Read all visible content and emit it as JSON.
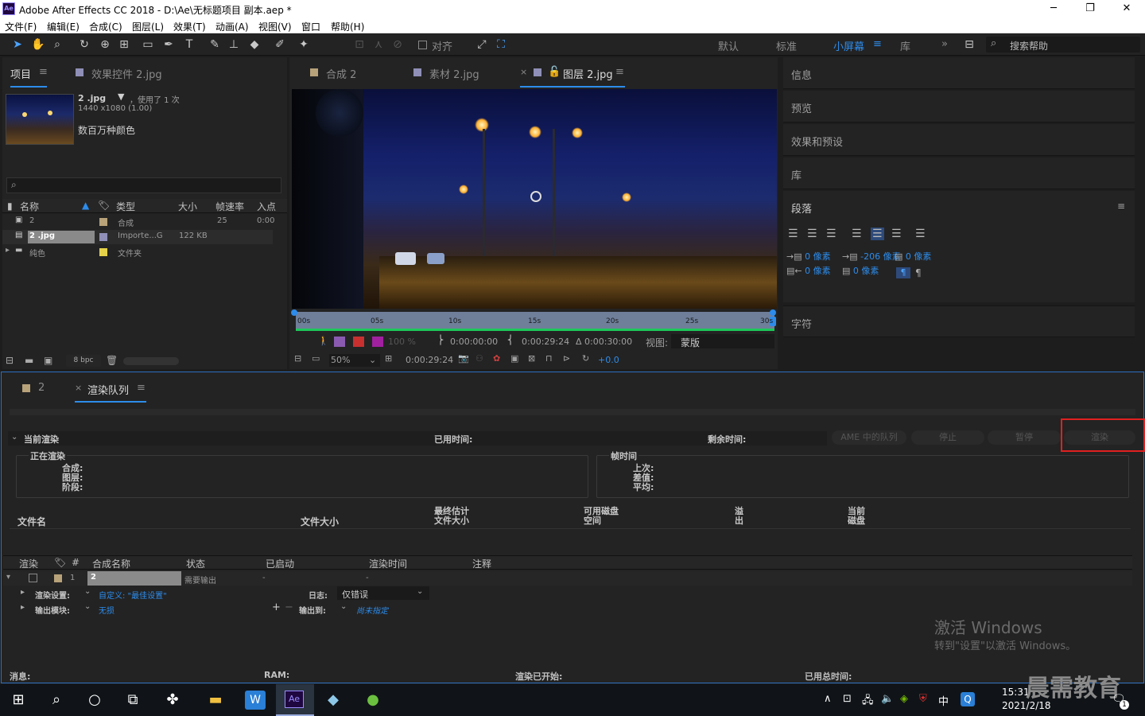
{
  "window": {
    "title": "Adobe After Effects CC 2018 - D:\\Ae\\无标题项目 副本.aep *",
    "app_badge": "Ae"
  },
  "menu": [
    "文件(F)",
    "编辑(E)",
    "合成(C)",
    "图层(L)",
    "效果(T)",
    "动画(A)",
    "视图(V)",
    "窗口",
    "帮助(H)"
  ],
  "toolbar": {
    "snap_label": "对齐",
    "workspaces": [
      "默认",
      "标准",
      "小屏幕",
      "库"
    ],
    "active_workspace": "小屏幕",
    "search_placeholder": "搜索帮助"
  },
  "project_panel": {
    "tab_project": "项目",
    "tab_effects": "效果控件 2.jpg",
    "thumb": {
      "name": "2 .jpg",
      "usage": "，使用了 1 次",
      "dimensions": "1440 x1080 (1.00)",
      "colors": "数百万种颜色"
    },
    "columns": [
      "名称",
      "类型",
      "大小",
      "帧速率",
      "入点"
    ],
    "rows": [
      {
        "name": "2",
        "type": "合成",
        "size": "",
        "fps": "25",
        "in": "0:00"
      },
      {
        "name": "2 .jpg",
        "type": "Importe...G",
        "size": "122 KB",
        "fps": "",
        "in": ""
      },
      {
        "name": "纯色",
        "type": "文件夹",
        "size": "",
        "fps": "",
        "in": ""
      }
    ],
    "bpc": "8 bpc"
  },
  "viewer": {
    "tabs": [
      "合成 2",
      "素材 2.jpg",
      "图层 2.jpg"
    ],
    "ruler": [
      "00s",
      "05s",
      "10s",
      "15s",
      "20s",
      "25s",
      "30s"
    ],
    "opacity": "100 %",
    "in_time": "0:00:00:00",
    "out_time": "0:00:29:24",
    "duration": "Δ 0:00:30:00",
    "view_label": "视图:",
    "view_value": "蒙版",
    "zoom": "50%",
    "current_time": "0:00:29:24",
    "exposure": "+0.0"
  },
  "right_panels": {
    "info": "信息",
    "preview": "预览",
    "effects": "效果和预设",
    "library": "库",
    "paragraph": "段落",
    "character": "字符",
    "indent": {
      "left": "0 像素",
      "right": "0 像素",
      "first": "-206 像素",
      "before": "0 像素",
      "after": "0 像素"
    }
  },
  "render_queue": {
    "tab_comp": "2",
    "tab_rq": "渲染队列",
    "current_render": "当前渲染",
    "elapsed": "已用时间:",
    "remaining": "剩余时间:",
    "buttons": {
      "ame": "AME 中的队列",
      "stop": "停止",
      "pause": "暂停",
      "render": "渲染"
    },
    "rendering": {
      "title": "正在渲染",
      "comp": "合成:",
      "layer": "图层:",
      "stage": "阶段:"
    },
    "frame_time": {
      "title": "帧时间",
      "last": "上次:",
      "diff": "差值:",
      "avg": "平均:"
    },
    "stats": {
      "file_name": "文件名",
      "file_size": "文件大小",
      "est_final_1": "最终估计",
      "est_final_2": "文件大小",
      "disk_1": "可用磁盘",
      "disk_2": "空间",
      "overflow_1": "溢",
      "overflow_2": "出",
      "cur_disk_1": "当前",
      "cur_disk_2": "磁盘"
    },
    "columns": [
      "渲染",
      "#",
      "合成名称",
      "状态",
      "已启动",
      "渲染时间",
      "注释"
    ],
    "item": {
      "num": "1",
      "name": "2",
      "status": "需要输出",
      "started": "-",
      "render_time": "-"
    },
    "render_settings_label": "渲染设置:",
    "render_settings_value": "自定义: \"最佳设置\"",
    "log_label": "日志:",
    "log_value": "仅错误",
    "output_module_label": "输出模块:",
    "output_module_value": "无损",
    "output_to_label": "输出到:",
    "output_to_value": "尚未指定",
    "footer": {
      "msg": "消息:",
      "ram": "RAM:",
      "started": "渲染已开始:",
      "total": "已用总时间:"
    }
  },
  "watermark": {
    "line1": "激活 Windows",
    "line2": "转到\"设置\"以激活 Windows。"
  },
  "taskbar": {
    "time": "15:31",
    "date": "2021/2/18",
    "ime": "中",
    "notif": "1",
    "brand": "晨需教育"
  },
  "colors": {
    "accent": "#2d8ceb",
    "highlight_red": "#e02020"
  }
}
